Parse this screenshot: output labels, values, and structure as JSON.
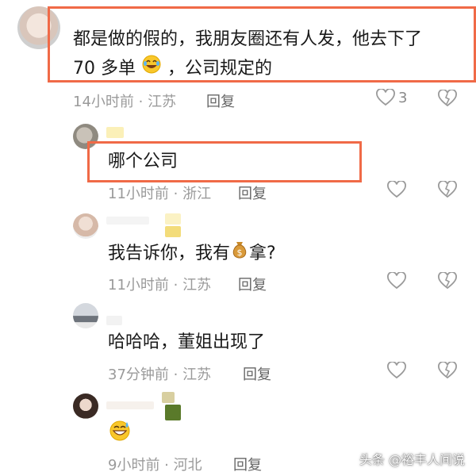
{
  "colors": {
    "highlight": "#f06a47",
    "meta": "#9a9a9a"
  },
  "comments": [
    {
      "line1": "都是做的假的，我朋友圈还有人发，他去下了",
      "line2_prefix": "70 多单",
      "line2_suffix": "，公司规定的",
      "emoji": "rofl-emoji",
      "meta": "14小时前 · 江苏",
      "reply": "回复",
      "likes": "3"
    },
    {
      "text": "哪个公司",
      "meta": "11小时前 · 浙江",
      "reply": "回复"
    },
    {
      "text_prefix": "我告诉你，我有",
      "text_suffix": "拿?",
      "emoji": "money-bag-emoji",
      "meta": "11小时前 · 江苏",
      "reply": "回复"
    },
    {
      "text": "哈哈哈，董姐出现了",
      "meta": "37分钟前 · 江苏",
      "reply": "回复"
    },
    {
      "emoji": "grin-sweat-emoji",
      "meta": "9小时前 · 河北",
      "reply": "回复"
    }
  ],
  "watermark": "头条 @裕丰人间说"
}
